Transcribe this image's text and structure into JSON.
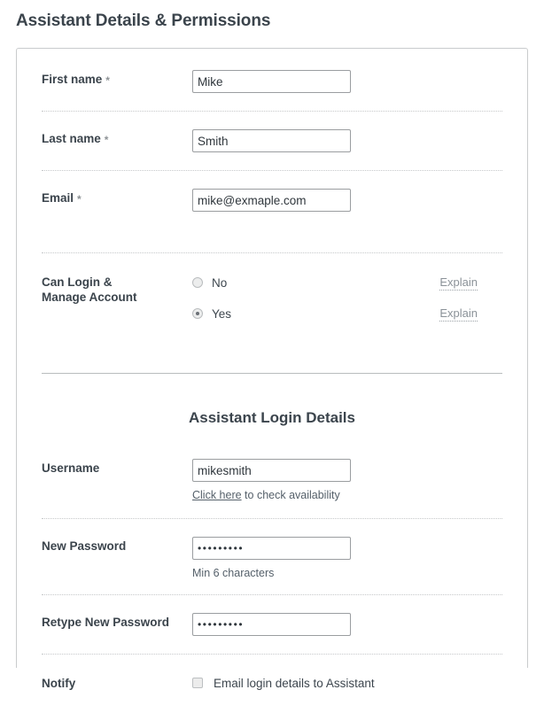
{
  "page": {
    "title": "Assistant Details & Permissions"
  },
  "form": {
    "first_name": {
      "label": "First name",
      "required_marker": "*",
      "value": "Mike",
      "placeholder": ""
    },
    "last_name": {
      "label": "Last name",
      "required_marker": "*",
      "value": "Smith",
      "placeholder": ""
    },
    "email": {
      "label": "Email",
      "required_marker": "*",
      "value": "mike@exmaple.com",
      "placeholder": ""
    },
    "can_login": {
      "label_line1": "Can Login &",
      "label_line2": "Manage Account",
      "options": [
        {
          "label": "No",
          "selected": false,
          "explain_label": "Explain"
        },
        {
          "label": "Yes",
          "selected": true,
          "explain_label": "Explain"
        }
      ]
    }
  },
  "login_section": {
    "heading": "Assistant Login Details",
    "username": {
      "label": "Username",
      "value": "mikesmith",
      "placeholder": "",
      "helper_link": "Click here",
      "helper_rest": " to check availability"
    },
    "new_password": {
      "label": "New Password",
      "value": "•••••••••",
      "placeholder": "",
      "helper": "Min 6 characters"
    },
    "retype_password": {
      "label": "Retype New Password",
      "value": "•••••••••",
      "placeholder": ""
    },
    "notify": {
      "label": "Notify",
      "checkbox_label": "Email login details to Assistant",
      "checked": false
    }
  },
  "colors": {
    "heading": "#3b444c",
    "text": "#3d464e",
    "muted": "#8b9298",
    "input_border": "#9a9da0",
    "card_border": "#c9cbcd"
  }
}
